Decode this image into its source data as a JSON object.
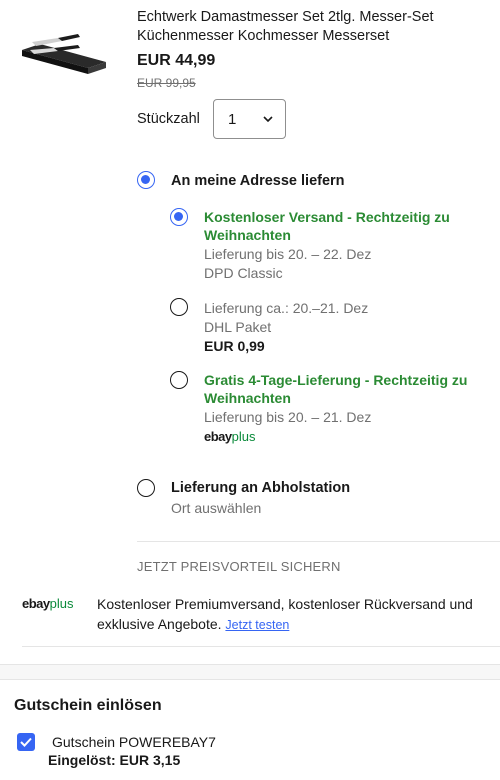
{
  "product": {
    "title": "Echtwerk Damastmesser Set 2tlg. Messer-Set Küchenmesser Kochmesser Messerset",
    "price": "EUR 44,99",
    "old_price": "EUR 99,95",
    "quantity_label": "Stückzahl",
    "quantity_value": "1",
    "image_icon": "knife-set-image"
  },
  "delivery": {
    "address_option": "An meine Adresse liefern",
    "options": [
      {
        "title": "Kostenloser Versand - Rechtzeitig zu Weihnachten",
        "line1": "Lieferung bis 20. – 22. Dez",
        "line2": "DPD Classic",
        "selected": true
      },
      {
        "title": "Lieferung ca.: 20.–21. Dez",
        "line1": "DHL Paket",
        "line2": "EUR 0,99",
        "selected": false
      },
      {
        "title": "Gratis 4-Tage-Lieferung - Rechtzeitig zu Weihnachten",
        "line1": "Lieferung bis 20. – 21. Dez",
        "badge_ebay": "ebay",
        "badge_plus": "plus",
        "selected": false
      }
    ],
    "pickup_option": "Lieferung an Abholstation",
    "pickup_sub": "Ort auswählen"
  },
  "promo": {
    "heading": "JETZT PREISVORTEIL SICHERN",
    "logo_ebay": "ebay",
    "logo_plus": "plus",
    "text": "Kostenloser Premiumversand, kostenloser Rückversand und exklusive Angebote.",
    "link": "Jetzt testen"
  },
  "coupon": {
    "title": "Gutschein einlösen",
    "code": "Gutschein POWEREBAY7",
    "applied": "Eingelöst: EUR 3,15",
    "checked": true
  },
  "colors": {
    "accent": "#3665f3",
    "green": "#2b8b34",
    "muted": "#707070"
  }
}
